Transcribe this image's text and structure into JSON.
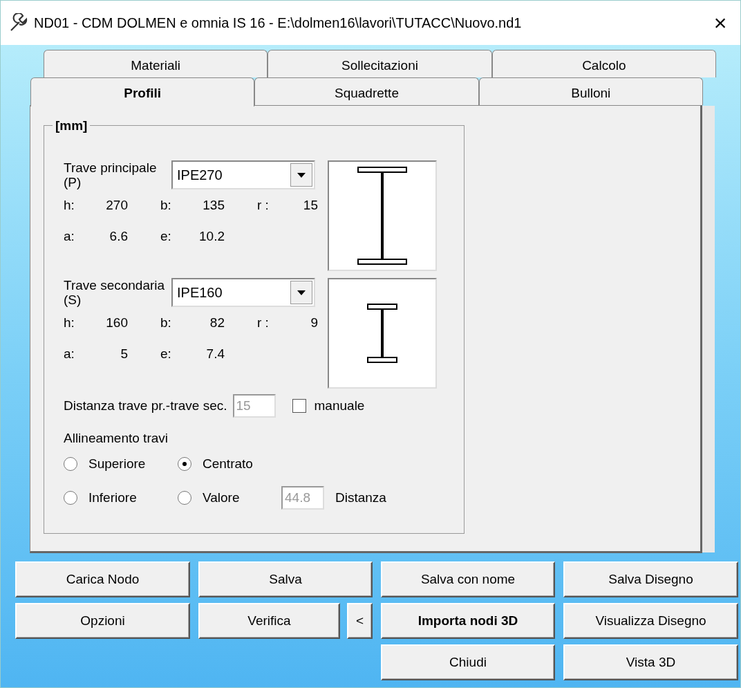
{
  "window": {
    "title": "ND01 - CDM DOLMEN e omnia IS 16 - E:\\dolmen16\\lavori\\TUTACC\\Nuovo.nd1",
    "close": "×"
  },
  "tab_rows": [
    [
      {
        "label": "Materiali",
        "selected": false
      },
      {
        "label": "Sollecitazioni",
        "selected": false
      },
      {
        "label": "Calcolo",
        "selected": false
      }
    ],
    [
      {
        "label": "Profili",
        "selected": true
      },
      {
        "label": "Squadrette",
        "selected": false
      },
      {
        "label": "Bulloni",
        "selected": false
      }
    ]
  ],
  "group": {
    "legend": "[mm]",
    "beams": [
      {
        "label": "Trave principale (P)",
        "value": "IPE270",
        "props": [
          [
            {
              "label": "h:",
              "value": "270"
            },
            {
              "label": "b:",
              "value": "135"
            },
            {
              "label": "r :",
              "value": "15"
            }
          ],
          [
            {
              "label": "a:",
              "value": "6.6"
            },
            {
              "label": "e:",
              "value": "10.2"
            }
          ]
        ]
      },
      {
        "label": "Trave secondaria (S)",
        "value": "IPE160",
        "props": [
          [
            {
              "label": "h:",
              "value": "160"
            },
            {
              "label": "b:",
              "value": "82"
            },
            {
              "label": "r :",
              "value": "9"
            }
          ],
          [
            {
              "label": "a:",
              "value": "5"
            },
            {
              "label": "e:",
              "value": "7.4"
            }
          ]
        ]
      }
    ],
    "distance": {
      "label": "Distanza trave pr.-trave sec.",
      "value": "15",
      "disabled": true
    },
    "manual": {
      "label": "manuale",
      "checked": false
    },
    "alignment": {
      "label": "Allineamento travi",
      "options": [
        {
          "label": "Superiore",
          "selected": false
        },
        {
          "label": "Centrato",
          "selected": true
        },
        {
          "label": "Inferiore",
          "selected": false
        },
        {
          "label": "Valore",
          "selected": false
        }
      ],
      "offset": {
        "value": "44.8",
        "disabled": true,
        "label": "Distanza"
      }
    }
  },
  "button_rows": [
    [
      {
        "label": "Carica Nodo",
        "kind": "wide",
        "default": false
      },
      {
        "label": "Salva",
        "kind": "wide",
        "default": false
      },
      {
        "label": "Salva con nome",
        "kind": "wide",
        "default": false
      },
      {
        "label": "Salva Disegno",
        "kind": "wide",
        "default": false
      }
    ],
    [
      {
        "label": "Opzioni",
        "kind": "wide",
        "default": false
      },
      {
        "label": "Verifica",
        "kind": "medium",
        "default": false
      },
      {
        "label": "<",
        "kind": "small",
        "default": false
      },
      {
        "label": "Importa nodi 3D",
        "kind": "wide",
        "default": true
      },
      {
        "label": "Visualizza Disegno",
        "kind": "wide",
        "default": false
      }
    ],
    [
      {
        "label": "Chiudi",
        "kind": "wide",
        "default": false
      },
      {
        "label": "Vista 3D",
        "kind": "wide",
        "default": false
      }
    ]
  ]
}
